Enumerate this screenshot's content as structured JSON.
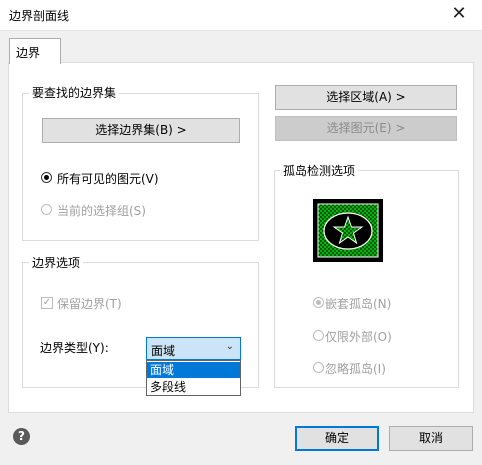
{
  "window": {
    "title": "边界剖面线",
    "close_glyph": "✕"
  },
  "tabs": [
    {
      "label": "边界"
    }
  ],
  "boundary_set": {
    "title": "要查找的边界集",
    "select_button": "选择边界集(B) >",
    "radio_all_visible": "所有可见的图元(V)",
    "radio_current_selection": "当前的选择组(S)"
  },
  "right_buttons": {
    "select_region": "选择区域(A) >",
    "select_entities": "选择图元(E) >"
  },
  "boundary_options": {
    "title": "边界选项",
    "keep_boundary": "保留边界(T)",
    "type_label": "边界类型(Y):",
    "type_value": "面域",
    "type_options": [
      "面域",
      "多段线"
    ]
  },
  "island_detection": {
    "title": "孤岛检测选项",
    "nested": "嵌套孤岛(N)",
    "outer_only": "仅限外部(O)",
    "ignore": "忽略孤岛(I)"
  },
  "footer": {
    "help_glyph": "?",
    "ok": "确定",
    "cancel": "取消"
  },
  "colors": {
    "accent": "#0078d7",
    "hatch_green": "#00c000"
  }
}
